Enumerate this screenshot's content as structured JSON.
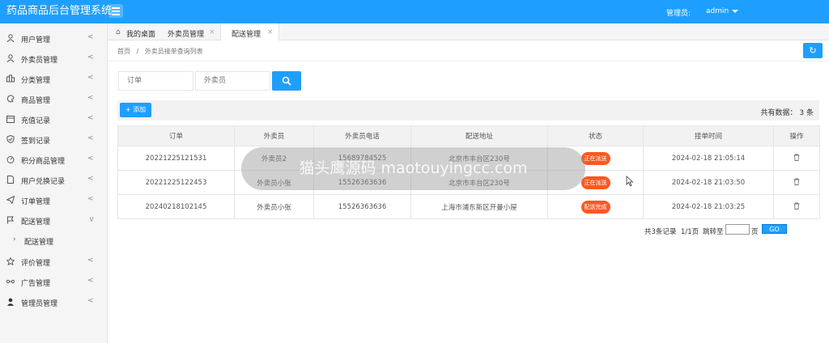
{
  "app": {
    "title": "药品商品后台管理系统",
    "admin_label": "管理员:",
    "admin_name": "admin"
  },
  "sidebar": {
    "items": [
      {
        "label": "用户管理",
        "icon": "user-icon"
      },
      {
        "label": "外卖员管理",
        "icon": "user-icon"
      },
      {
        "label": "分类管理",
        "icon": "category-icon"
      },
      {
        "label": "商品管理",
        "icon": "palette-icon"
      },
      {
        "label": "充值记录",
        "icon": "calendar-icon"
      },
      {
        "label": "签到记录",
        "icon": "shield-icon"
      },
      {
        "label": "积分商品管理",
        "icon": "gauge-icon"
      },
      {
        "label": "用户兑换记录",
        "icon": "document-icon"
      },
      {
        "label": "订单管理",
        "icon": "send-icon"
      },
      {
        "label": "配送管理",
        "icon": "flag-icon"
      },
      {
        "label": "评价管理",
        "icon": "star-icon"
      },
      {
        "label": "广告管理",
        "icon": "link-icon"
      },
      {
        "label": "管理员管理",
        "icon": "person-icon"
      }
    ],
    "sub_item": "配送管理"
  },
  "tabs": [
    {
      "label": "我的桌面",
      "icon": "home-icon"
    },
    {
      "label": "外卖员管理",
      "close": "×"
    },
    {
      "label": "配送管理",
      "close": "×"
    }
  ],
  "breadcrumb": {
    "home": "首页",
    "sep": "/",
    "current": "外卖员接单查询列表"
  },
  "search": {
    "order_placeholder": "订单",
    "courier_placeholder": "外卖员"
  },
  "toolbar": {
    "add_label": "+ 添加",
    "total": "共有数据： 3 条"
  },
  "table": {
    "columns": [
      "订单",
      "外卖员",
      "外卖员电话",
      "配送地址",
      "状态",
      "接单时间",
      "操作"
    ],
    "rows": [
      {
        "order": "20221225121531",
        "courier": "外卖员2",
        "phone": "15689784525",
        "address": "北京市丰台区230号",
        "status": "正在派送",
        "time": "2024-02-18 21:05:14"
      },
      {
        "order": "20221225122453",
        "courier": "外卖员小张",
        "phone": "15526363636",
        "address": "北京市丰台区230号",
        "status": "正在派送",
        "time": "2024-02-18 21:03:50"
      },
      {
        "order": "20240218102145",
        "courier": "外卖员小张",
        "phone": "15526363636",
        "address": "上海市浦东新区开曼小屋",
        "status": "配送完成",
        "time": "2024-02-18 21:03:25"
      }
    ]
  },
  "pager": {
    "summary": "共3条记录",
    "pages": "1/1页",
    "jump_label": "跳转至",
    "page_unit": "页",
    "go_label": "GO"
  },
  "watermark": "猫头鹰源码 maotouyingcc.com",
  "colors": {
    "primary": "#1e9fff",
    "status": "#ff5722"
  }
}
